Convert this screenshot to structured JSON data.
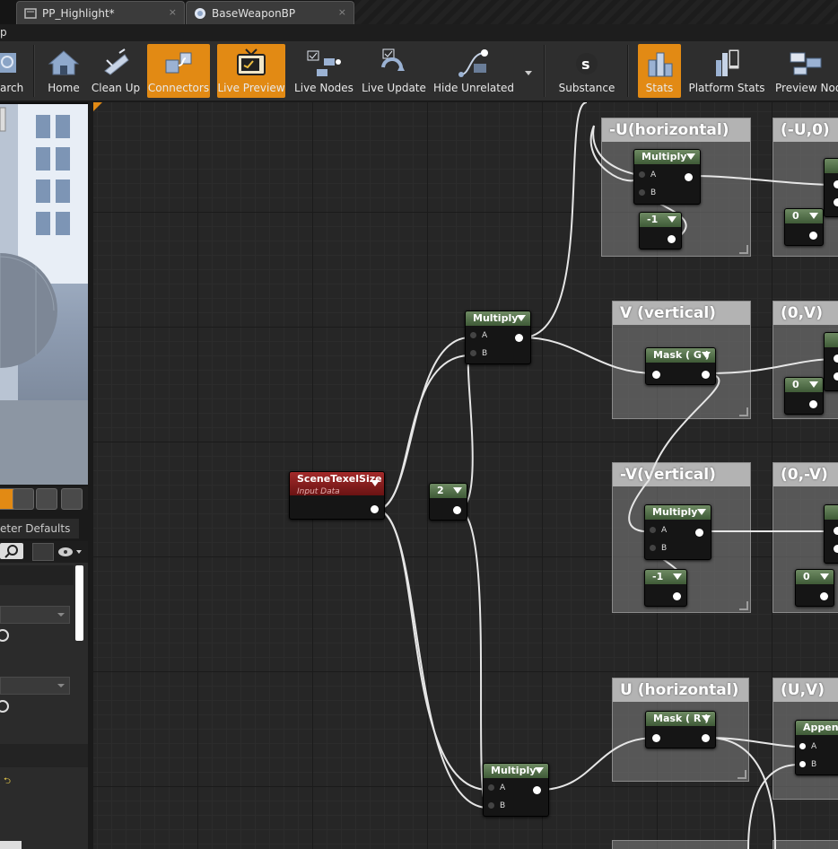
{
  "tabs": [
    {
      "label": "PP_Highlight*",
      "icon": "material-icon",
      "close": "×"
    },
    {
      "label": "BaseWeaponBP",
      "icon": "blueprint-icon",
      "close": "×"
    }
  ],
  "menu": {
    "partial": "p"
  },
  "toolbar": {
    "buttons": [
      {
        "label": "arch",
        "icon": "search-icon",
        "active": false
      },
      {
        "label": "Home",
        "icon": "home-icon",
        "active": false
      },
      {
        "label": "Clean Up",
        "icon": "clean-up-icon",
        "active": false
      },
      {
        "label": "Connectors",
        "icon": "connectors-icon",
        "active": true
      },
      {
        "label": "Live Preview",
        "icon": "tv-icon",
        "active": true
      },
      {
        "label": "Live Nodes",
        "icon": "live-nodes-icon",
        "active": false
      },
      {
        "label": "Live Update",
        "icon": "live-update-icon",
        "active": false
      },
      {
        "label": "Hide Unrelated",
        "icon": "hide-unrelated-icon",
        "active": false
      },
      {
        "label": "Substance",
        "icon": "substance-icon",
        "active": false
      },
      {
        "label": "Stats",
        "icon": "stats-icon",
        "active": true
      },
      {
        "label": "Platform Stats",
        "icon": "platform-stats-icon",
        "active": false
      },
      {
        "label": "Preview Node",
        "icon": "preview-node-icon",
        "active": false
      }
    ]
  },
  "left_panel": {
    "param_tab": "eter Defaults"
  },
  "colors": {
    "active": "#e28a14",
    "node_header": "#4f6b45",
    "scene_node": "#8a1f1f",
    "comment_title": "#b3b3b3"
  },
  "comments": [
    {
      "title": "-U(horizontal)"
    },
    {
      "title": "(-U,0)"
    },
    {
      "title": "V (vertical)"
    },
    {
      "title": "(0,V)"
    },
    {
      "title": "-V(vertical)"
    },
    {
      "title": "(0,-V)"
    },
    {
      "title": "U (horizontal)"
    },
    {
      "title": "(U,V)"
    }
  ],
  "nodes": {
    "scene_texel": {
      "title": "SceneTexelSize",
      "subtitle": "Input Data"
    },
    "multiply_top": {
      "title": "Multiply",
      "a": "A",
      "b": "B"
    },
    "multiply_bottom": {
      "title": "Multiply",
      "a": "A",
      "b": "B"
    },
    "const_2": {
      "title": "2"
    },
    "multiply_neg_u": {
      "title": "Multiply",
      "a": "A",
      "b": "B"
    },
    "const_neg1_u": {
      "title": "-1"
    },
    "const_0_u": {
      "title": "0"
    },
    "mask_g": {
      "title": "Mask ( G )"
    },
    "const_0_v": {
      "title": "0"
    },
    "multiply_neg_v": {
      "title": "Multiply",
      "a": "A",
      "b": "B"
    },
    "const_neg1_v": {
      "title": "-1"
    },
    "const_0_negv": {
      "title": "0"
    },
    "mask_r": {
      "title": "Mask ( R )"
    },
    "append_uv": {
      "title": "Append",
      "a": "A",
      "b": "B"
    }
  }
}
